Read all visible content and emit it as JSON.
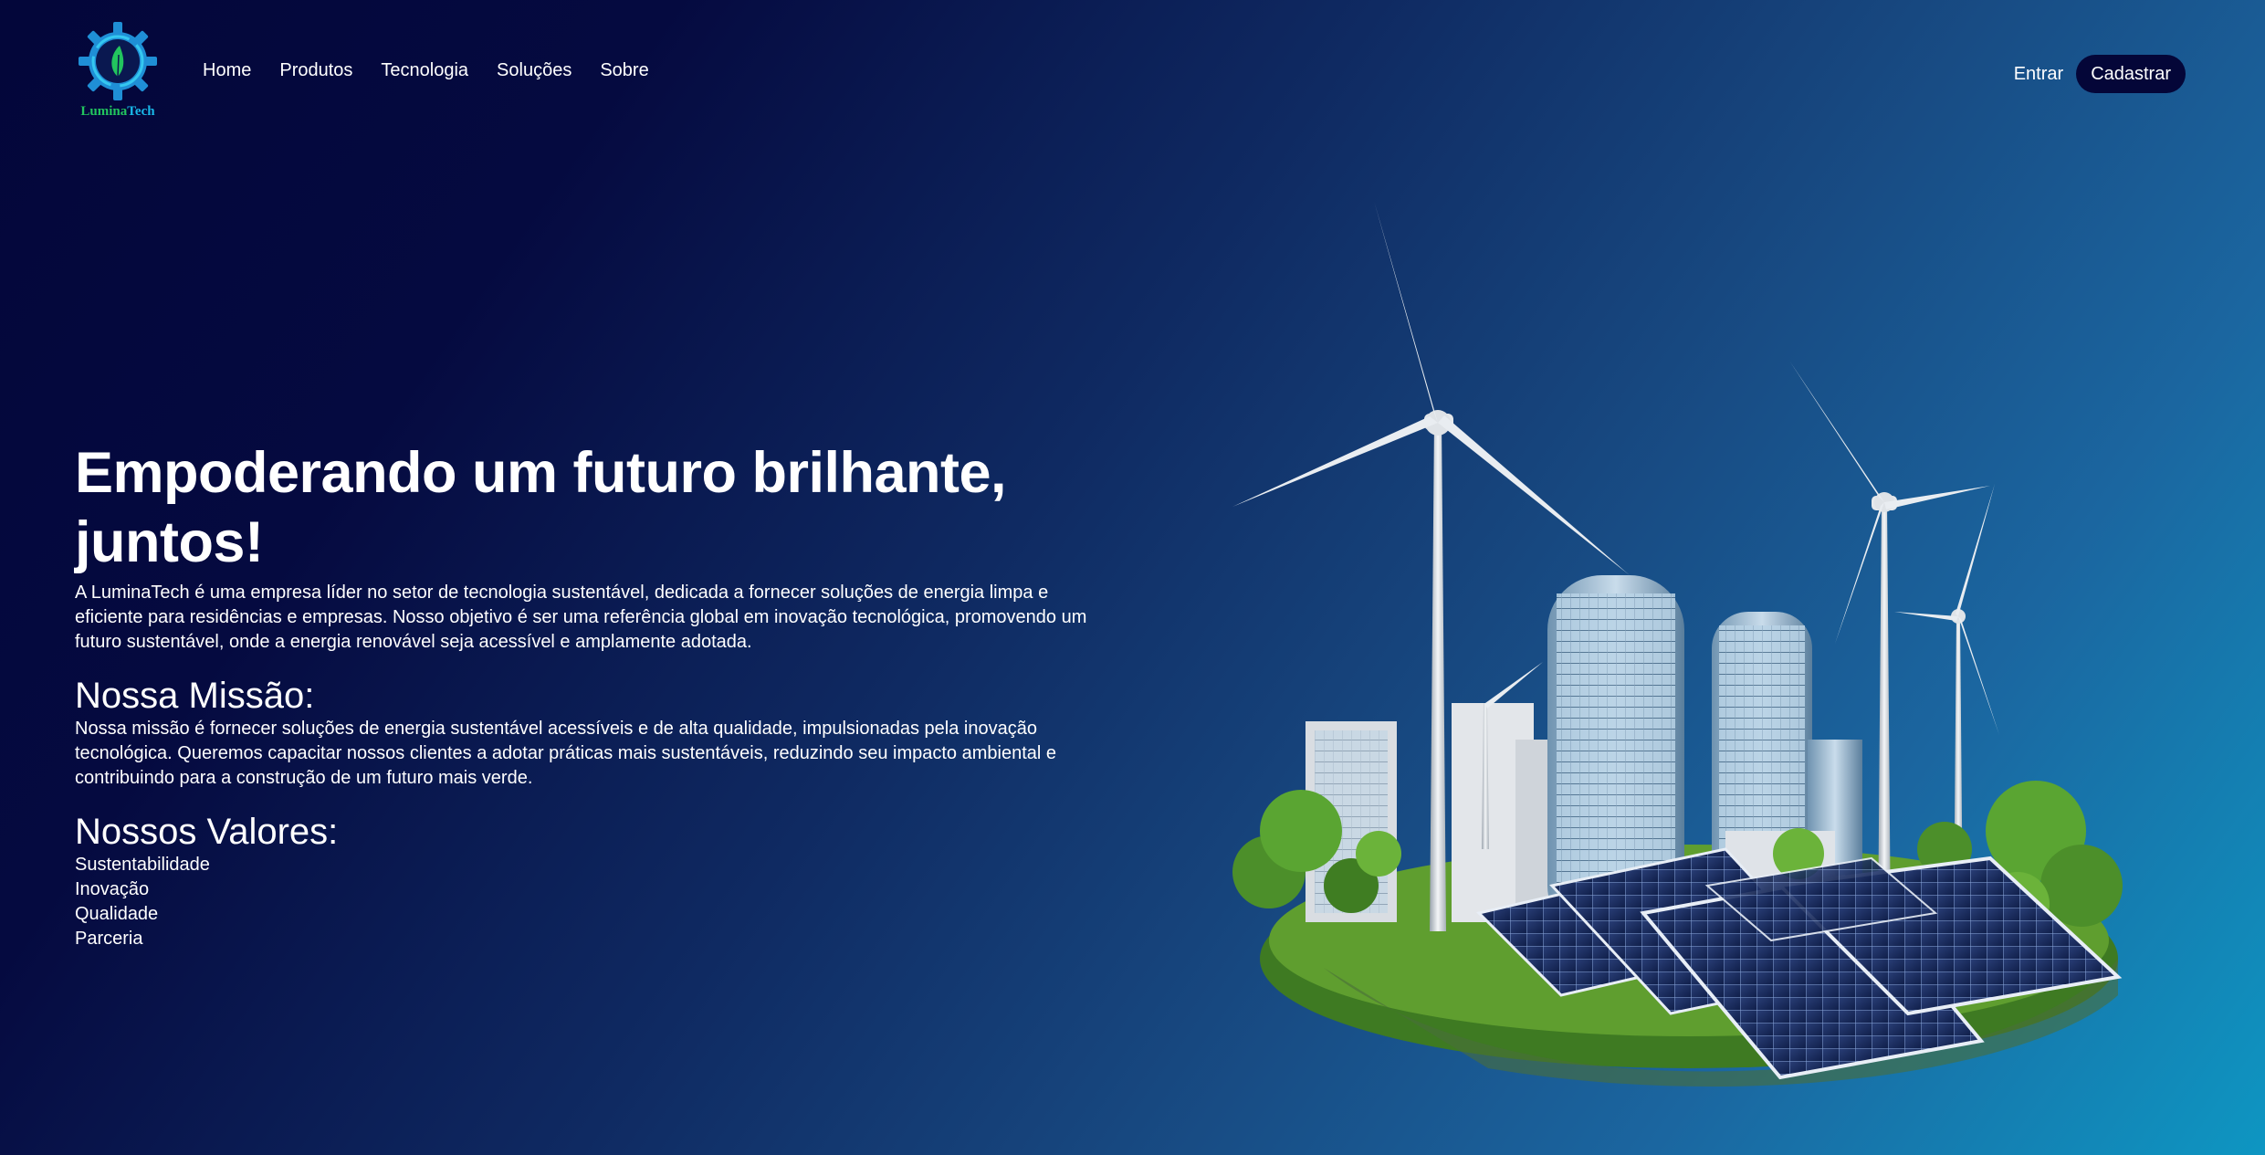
{
  "brand": {
    "name_part1": "Lumina",
    "name_part2": "Tech",
    "logo_icon": "gear-leaf-icon",
    "colors": {
      "green": "#22c55e",
      "cyan": "#19b8e8",
      "navy": "#040638"
    }
  },
  "nav": {
    "items": [
      {
        "label": "Home"
      },
      {
        "label": "Produtos"
      },
      {
        "label": "Tecnologia"
      },
      {
        "label": "Soluções"
      },
      {
        "label": "Sobre"
      }
    ],
    "login_label": "Entrar",
    "signup_label": "Cadastrar"
  },
  "hero": {
    "title": "Empoderando um futuro brilhante, juntos!",
    "description": "A LuminaTech é uma empresa líder no setor de tecnologia sustentável, dedicada a fornecer soluções de energia limpa e eficiente para residências e empresas. Nosso objetivo é ser uma referência global em inovação tecnológica, promovendo um futuro sustentável, onde a energia renovável seja acessível e amplamente adotada."
  },
  "mission": {
    "title": "Nossa Missão:",
    "text": "Nossa missão é fornecer soluções de energia sustentável acessíveis e de alta qualidade, impulsionadas pela inovação tecnológica. Queremos capacitar nossos clientes a adotar práticas mais sustentáveis, reduzindo seu impacto ambiental e contribuindo para a construção de um futuro mais verde."
  },
  "values": {
    "title": "Nossos Valores:",
    "items": [
      "Sustentabilidade",
      "Inovação",
      "Qualidade",
      "Parceria"
    ]
  },
  "illustration": {
    "subject": "wind-turbines-solar-city-illustration"
  }
}
